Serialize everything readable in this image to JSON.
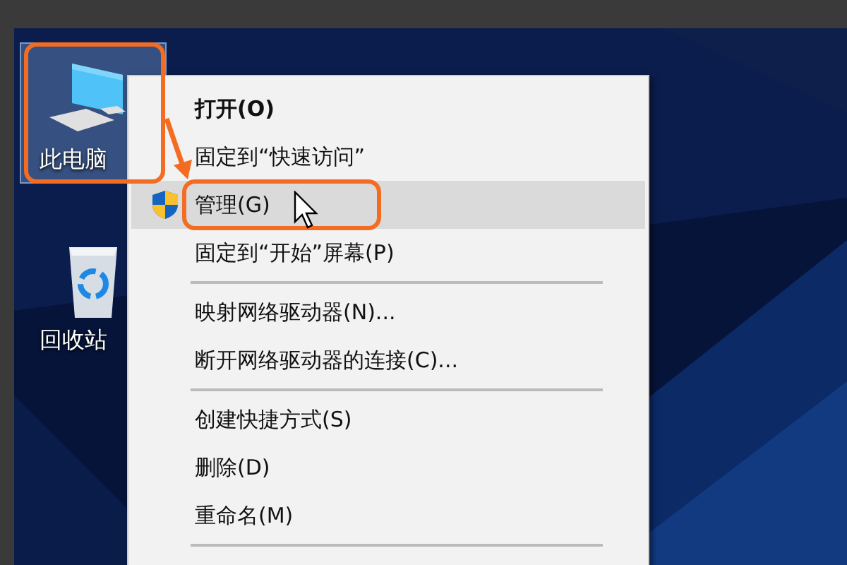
{
  "desktop_icons": [
    {
      "label": "此电脑",
      "kind": "computer",
      "selected": true
    },
    {
      "label": "回收站",
      "kind": "recycle-bin",
      "selected": false
    }
  ],
  "context_menu": {
    "items": [
      {
        "kind": "item",
        "label": "打开(O)",
        "default": true,
        "selected": false
      },
      {
        "kind": "item",
        "label": "固定到“快速访问”",
        "default": false,
        "selected": false
      },
      {
        "kind": "admin-item",
        "label": "管理(G)",
        "default": false,
        "selected": true
      },
      {
        "kind": "item",
        "label": "固定到“开始”屏幕(P)",
        "default": false,
        "selected": false
      },
      {
        "kind": "separator"
      },
      {
        "kind": "item",
        "label": "映射网络驱动器(N)...",
        "default": false,
        "selected": false
      },
      {
        "kind": "item",
        "label": "断开网络驱动器的连接(C)...",
        "default": false,
        "selected": false
      },
      {
        "kind": "separator"
      },
      {
        "kind": "item",
        "label": "创建快捷方式(S)",
        "default": false,
        "selected": false
      },
      {
        "kind": "item",
        "label": "删除(D)",
        "default": false,
        "selected": false
      },
      {
        "kind": "item",
        "label": "重命名(M)",
        "default": false,
        "selected": false
      },
      {
        "kind": "separator"
      }
    ]
  }
}
